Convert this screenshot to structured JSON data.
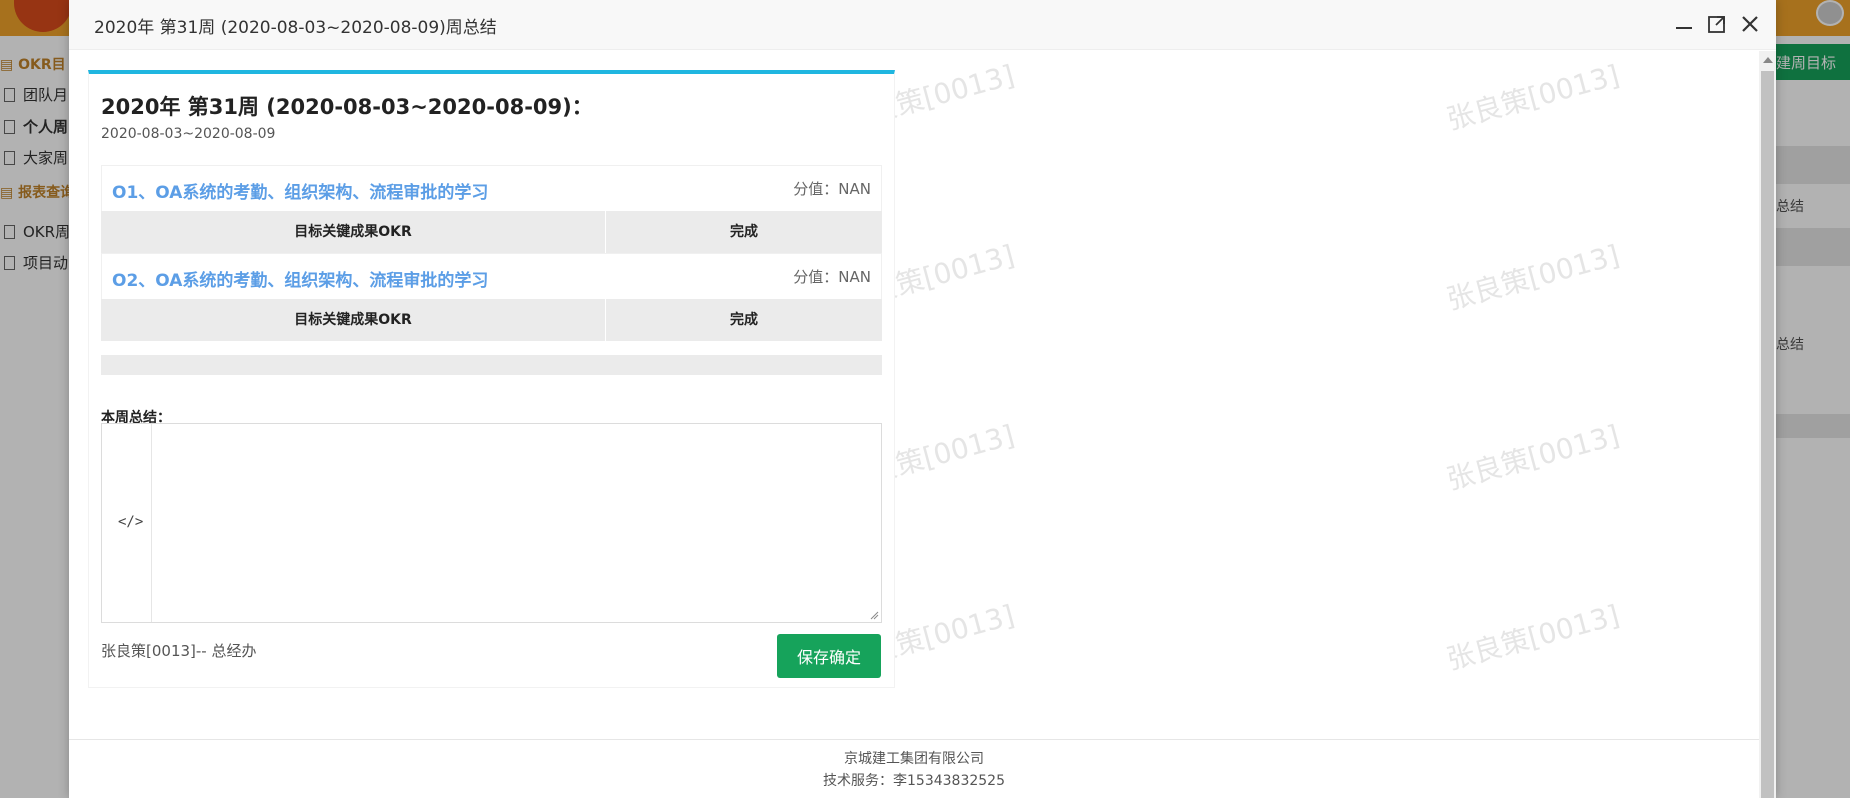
{
  "background": {
    "sidebar": {
      "groups": [
        "OKR目",
        "报表查询"
      ],
      "items": [
        "团队月",
        "个人周",
        "大家周",
        "OKR周",
        "项目动"
      ]
    },
    "right_panel": {
      "new_button": "建周目标",
      "labels": [
        "总结",
        "总结"
      ]
    }
  },
  "modal": {
    "title": "2020年 第31周 (2020-08-03~2020-08-09)周总结",
    "controls": {
      "minimize_icon": "minimize-icon",
      "maximize_icon": "maximize-icon",
      "close_icon": "close-icon"
    },
    "card": {
      "heading": "2020年 第31周 (2020-08-03~2020-08-09)：",
      "date_range": "2020-08-03~2020-08-09",
      "objectives": [
        {
          "name": "O1、OA系统的考勤、组织架构、流程审批的学习",
          "score": "分值：NAN",
          "col1": "目标关键成果OKR",
          "col2": "完成"
        },
        {
          "name": "O2、OA系统的考勤、组织架构、流程审批的学习",
          "score": "分值：NAN",
          "col1": "目标关键成果OKR",
          "col2": "完成"
        }
      ],
      "summary_label": "本周总结：",
      "editor_code_icon": "</>",
      "editor_value": "",
      "author": "张良策[0013]-- 总经办",
      "save_button": "保存确定"
    },
    "footer": {
      "company": "京城建工集团有限公司",
      "support": "技术服务：李15343832525"
    },
    "watermark": "张良策[0013]"
  },
  "colors": {
    "accent_blue": "#1fb6e0",
    "objective_link": "#5c9ee6",
    "save_green": "#16a35b",
    "topbar_orange": "#f0a32a"
  }
}
